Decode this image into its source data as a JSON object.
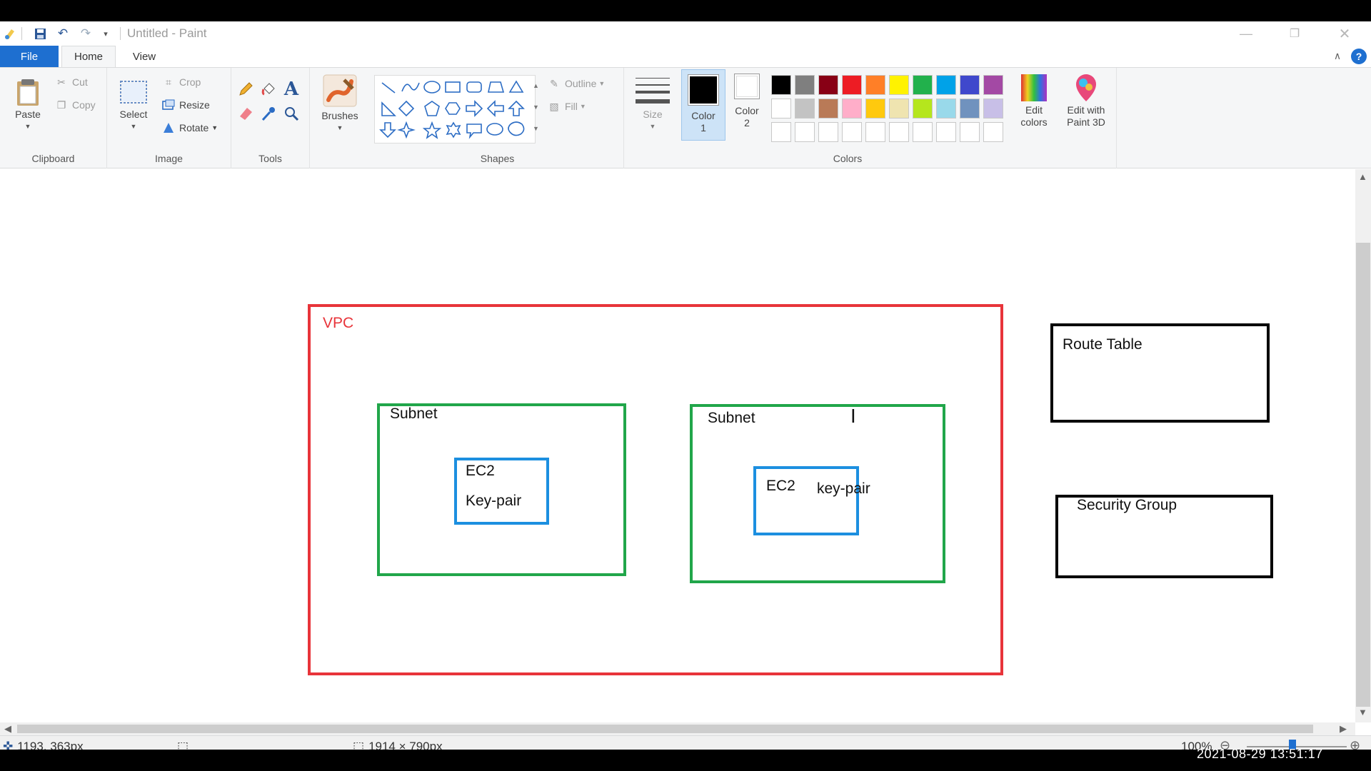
{
  "window": {
    "title": "Untitled - Paint",
    "controls": [
      "minimize",
      "restore",
      "close"
    ]
  },
  "tabs": {
    "file": "File",
    "home": "Home",
    "view": "View",
    "active": "Home"
  },
  "ribbon": {
    "clipboard": {
      "label": "Clipboard",
      "paste": "Paste",
      "cut": "Cut",
      "copy": "Copy"
    },
    "image": {
      "label": "Image",
      "select": "Select",
      "crop": "Crop",
      "resize": "Resize",
      "rotate": "Rotate"
    },
    "tools": {
      "label": "Tools"
    },
    "brushes": {
      "label": "Brushes"
    },
    "shapes": {
      "label": "Shapes",
      "outline": "Outline",
      "fill": "Fill"
    },
    "size": {
      "label": "Size"
    },
    "colors": {
      "label": "Colors",
      "color1": "Color",
      "color1_num": "1",
      "color1_value": "#000000",
      "color2": "Color",
      "color2_num": "2",
      "color2_value": "#ffffff",
      "edit_colors": "Edit",
      "edit_colors_2": "colors",
      "edit_paint3d": "Edit with",
      "edit_paint3d_2": "Paint 3D",
      "palette_row1": [
        "#000000",
        "#7f7f7f",
        "#880015",
        "#ed1c24",
        "#ff7f27",
        "#fff200",
        "#22b14c",
        "#00a2e8",
        "#3f48cc",
        "#a349a4"
      ],
      "palette_row2": [
        "#ffffff",
        "#c3c3c3",
        "#b97a57",
        "#ffaec9",
        "#ffc90e",
        "#efe4b0",
        "#b5e61d",
        "#99d9ea",
        "#7092be",
        "#c8bfe7"
      ],
      "palette_row3": [
        "#ffffff",
        "#ffffff",
        "#ffffff",
        "#ffffff",
        "#ffffff",
        "#ffffff",
        "#ffffff",
        "#ffffff",
        "#ffffff",
        "#ffffff"
      ]
    }
  },
  "diagram": {
    "vpc_label": "VPC",
    "subnet1_label": "Subnet",
    "ec2_1_label": "EC2",
    "keypair_1_label": "Key-pair",
    "subnet2_label": "Subnet",
    "ec2_2_label": "EC2",
    "keypair_2_label": "key-pair",
    "route_table_label": "Route Table",
    "security_group_label": "Security Group",
    "colors": {
      "vpc": "#e8343a",
      "subnet": "#21a64a",
      "ec2": "#1c8fe0",
      "other": "#000000"
    }
  },
  "status": {
    "cursor_pos": "1193, 363px",
    "canvas_size": "1914 × 790px",
    "zoom": "100%"
  },
  "overlay": {
    "timestamp": "2021-08-29  13:51:17"
  }
}
